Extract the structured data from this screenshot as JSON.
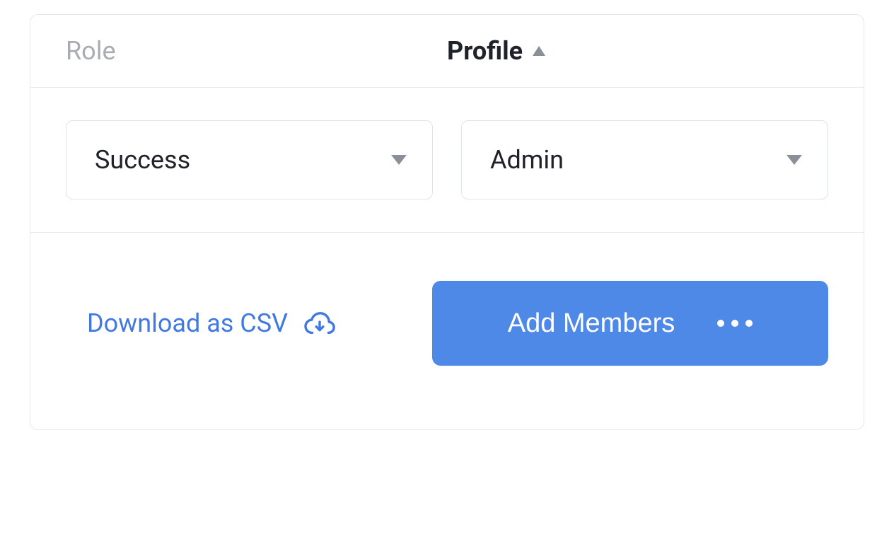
{
  "headers": {
    "role": "Role",
    "profile": "Profile"
  },
  "selects": {
    "role": {
      "selected": "Success"
    },
    "profile": {
      "selected": "Admin"
    }
  },
  "actions": {
    "download_label": "Download as CSV",
    "add_members_label": "Add Members"
  }
}
